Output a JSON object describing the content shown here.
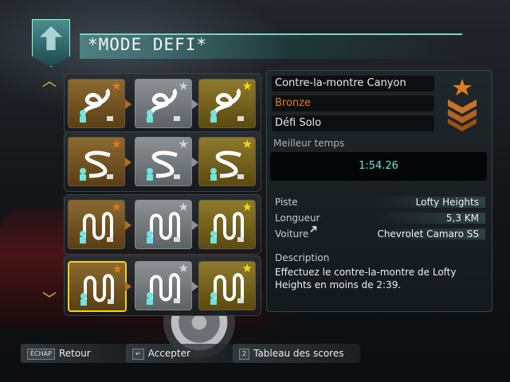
{
  "header": {
    "title": "*MODE DEFI*"
  },
  "challenge": {
    "name": "Contre-la-montre Canyon",
    "medal": "Bronze",
    "mode": "Défi Solo",
    "best_time_label": "Meilleur temps",
    "best_time": "1:54.26"
  },
  "details": {
    "track_label": "Piste",
    "track": "Lofty Heights",
    "length_label": "Longueur",
    "length": "5,3 KM",
    "car_label": "Voiture",
    "car": "Chevrolet Camaro SS",
    "description_label": "Description",
    "description": "Effectuez le contre-la-montre de Lofty Heights en moins de 2:39."
  },
  "grid": {
    "rows": [
      {
        "track_icon": "loop-track-icon",
        "medals": [
          "bronze",
          "silver",
          "gold"
        ],
        "selected": -1
      },
      {
        "track_icon": "s-curve-track-icon",
        "medals": [
          "bronze",
          "silver",
          "gold"
        ],
        "selected": -1
      },
      {
        "track_icon": "hairpin-track-icon",
        "medals": [
          "bronze",
          "silver",
          "gold"
        ],
        "selected": -1
      },
      {
        "track_icon": "hairpin-track-icon",
        "medals": [
          "bronze",
          "silver",
          "gold"
        ],
        "selected": 0
      }
    ]
  },
  "footer": {
    "back_key": "ÉCHAP",
    "back_label": "Retour",
    "accept_key": "↵",
    "accept_label": "Accepter",
    "scores_key": "2",
    "scores_label": "Tableau des scores"
  },
  "colors": {
    "accent": "#6fe3df",
    "bronze": "#e07a22",
    "gold": "#f2da1a",
    "silver": "#d0d3d6"
  }
}
